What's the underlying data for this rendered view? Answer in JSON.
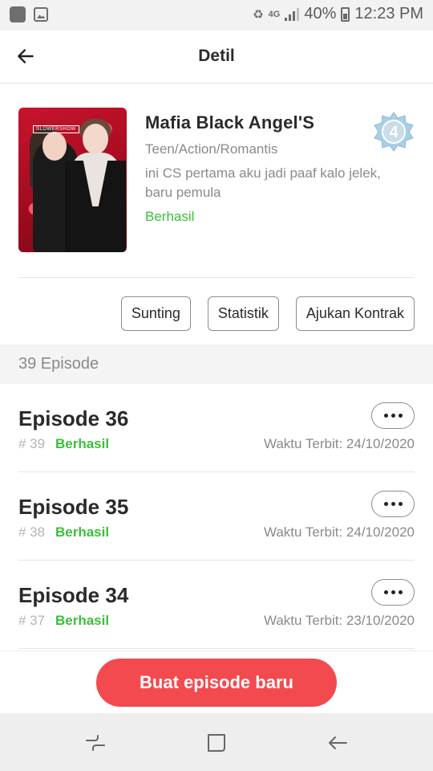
{
  "status_bar": {
    "battery": "40%",
    "time": "12:23 PM",
    "network": "4G",
    "icons": [
      "app-icon",
      "image-icon",
      "recycle-icon",
      "signal-icon",
      "battery-icon"
    ]
  },
  "header": {
    "title": "Detil",
    "back_icon": "arrow-left-icon"
  },
  "book": {
    "title": "Mafia Black Angel'S",
    "genre": "Teen/Action/Romantis",
    "description": "ini CS pertama aku jadi paaf kalo jelek, baru pemula",
    "status": "Berhasil",
    "level": "4",
    "cover_icon": "book-cover-image",
    "cover_tag": "SLOWERSHOW"
  },
  "actions": {
    "edit": "Sunting",
    "stats": "Statistik",
    "contract": "Ajukan Kontrak"
  },
  "episode_count": "39 Episode",
  "episodes": [
    {
      "title": "Episode 36",
      "number": "# 39",
      "status": "Berhasil",
      "publish": "Waktu Terbit: 24/10/2020"
    },
    {
      "title": "Episode 35",
      "number": "# 38",
      "status": "Berhasil",
      "publish": "Waktu Terbit: 24/10/2020"
    },
    {
      "title": "Episode 34",
      "number": "# 37",
      "status": "Berhasil",
      "publish": "Waktu Terbit: 23/10/2020"
    }
  ],
  "cta": {
    "label": "Buat episode baru"
  },
  "colors": {
    "accent_red": "#f24a4e",
    "success_green": "#3bbf3b",
    "text_dark": "#2a2a2a",
    "text_muted": "#8a8a8a"
  },
  "navbar": {
    "icons": [
      "recents-icon",
      "home-icon",
      "back-icon"
    ]
  }
}
